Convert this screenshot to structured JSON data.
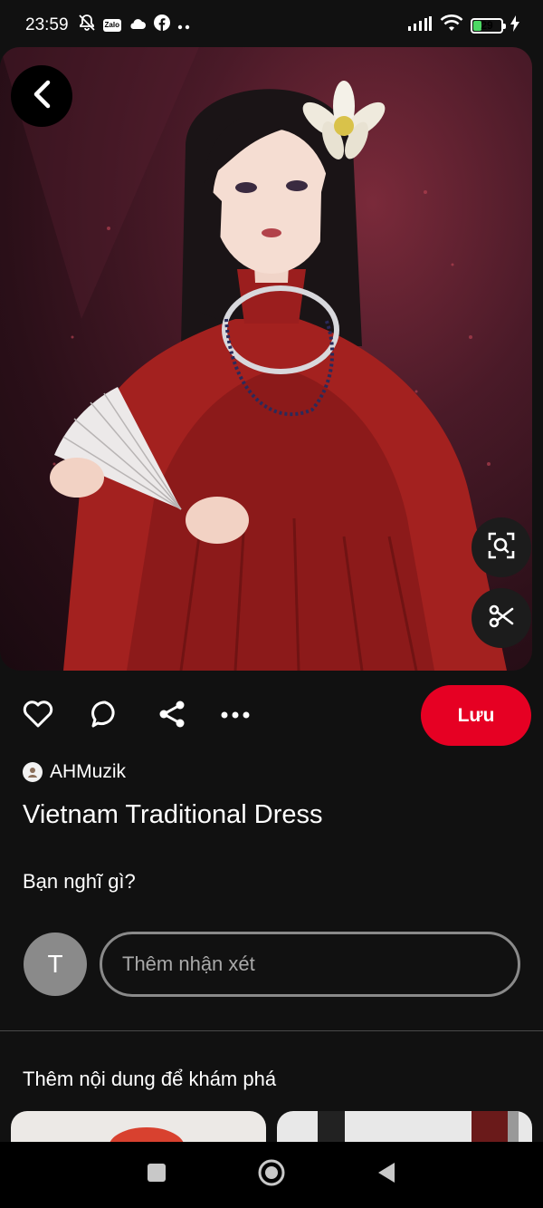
{
  "status_bar": {
    "time": "23:59",
    "notification_icons": [
      "bell-off-icon",
      "zalo-icon",
      "cloud-icon",
      "facebook-icon",
      "more-dots-icon"
    ],
    "zalo_label": "Zalo",
    "battery_level": "29",
    "battery_fraction": 0.29
  },
  "pin": {
    "image_alt": "Vietnam Traditional Dress",
    "author": "AHMuzik",
    "title": "Vietnam Traditional Dress"
  },
  "actions": {
    "save_label": "Lưu",
    "icons": [
      "heart-icon",
      "comment-icon",
      "share-icon",
      "more-icon"
    ]
  },
  "comments": {
    "prompt": "Bạn nghĩ gì?",
    "user_initial": "T",
    "input_placeholder": "Thêm nhận xét"
  },
  "explore": {
    "title": "Thêm nội dung để khám phá"
  },
  "colors": {
    "brand_red": "#e60023",
    "background": "#111111",
    "battery_green": "#4cd964"
  }
}
